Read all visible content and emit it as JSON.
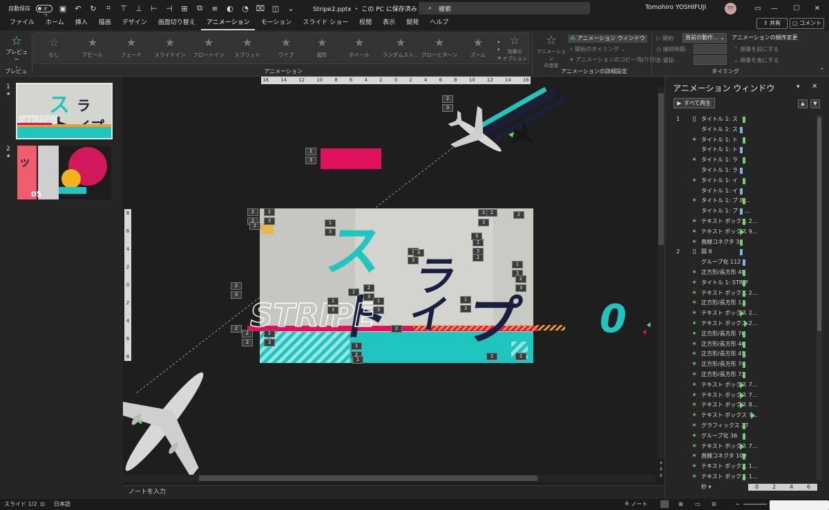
{
  "titlebar": {
    "autosave_label": "自動保存",
    "autosave_state": "オフ",
    "doc_title": "Stripe2.pptx ・ この PC に保存済み ⌄",
    "search_placeholder": "検索",
    "user_name": "Tomohiro YOSHIFUJI",
    "user_initials": "TY"
  },
  "tabs": [
    "ファイル",
    "ホーム",
    "挿入",
    "描画",
    "デザイン",
    "画面切り替え",
    "アニメーション",
    "モーション",
    "スライド ショー",
    "校閲",
    "表示",
    "開発",
    "ヘルプ"
  ],
  "active_tab": "アニメーション",
  "share_label": "共有",
  "comment_label": "コメント",
  "ribbon": {
    "preview_label": "プレビュー",
    "preview_group": "プレビュー",
    "animation_group": "アニメーション",
    "gallery": [
      "なし",
      "アピール",
      "フェード",
      "スライドイン",
      "フロートイン",
      "スプリット",
      "ワイプ",
      "図形",
      "ホイール",
      "ランダムスト…",
      "グローとターン",
      "ズーム"
    ],
    "effect_options": "効果の\nオプション",
    "add_animation": "アニメーション\nの追加",
    "anim_pane_btn": "アニメーション ウィンドウ",
    "start_timing": "開始のタイミング",
    "anim_copy": "アニメーションのコピー/貼り付け",
    "detail_group": "アニメーションの詳細設定",
    "start_label": "開始:",
    "start_value": "直前の動作…",
    "duration_label": "継続時間:",
    "delay_label": "遅延:",
    "reorder_label": "アニメーションの順序変更",
    "move_earlier": "順番を前にする",
    "move_later": "順番を後にする",
    "timing_group": "タイミング"
  },
  "slides": [
    {
      "num": "1",
      "star": "★"
    },
    {
      "num": "2",
      "star": "★"
    }
  ],
  "ruler_h": [
    "16",
    "14",
    "12",
    "10",
    "8",
    "6",
    "4",
    "2",
    "0",
    "2",
    "4",
    "6",
    "8",
    "10",
    "12",
    "14",
    "16"
  ],
  "ruler_v": [
    "8",
    "6",
    "4",
    "2",
    "0",
    "2",
    "4",
    "6",
    "8"
  ],
  "canvas": {
    "kana1": "ス",
    "kana2": "ト",
    "kana3": "ラ",
    "kana4": "イ",
    "kana5": "プ",
    "strip": "STRIPE",
    "zero": "0"
  },
  "notes_placeholder": "ノートを入力",
  "status": {
    "slide": "スライド 1/2",
    "lang": "日本語",
    "notes": "ノート"
  },
  "anim_pane": {
    "title": "アニメーション ウィンドウ",
    "play_all": "すべて再生",
    "items": [
      {
        "num": "1",
        "ic": "mouse",
        "label": "タイトル 1: ス",
        "color": "#6fd36f",
        "bar": 100,
        "kind": "bar"
      },
      {
        "num": "",
        "ic": "dot",
        "label": "タイトル 1: ス",
        "color": "#7fb4e6",
        "bar": 96,
        "kind": "bar"
      },
      {
        "num": "",
        "ic": "star",
        "label": "タイトル 1: ト",
        "color": "#6fd36f",
        "bar": 100,
        "kind": "bar"
      },
      {
        "num": "",
        "ic": "dot",
        "label": "タイトル 1: ト",
        "color": "#7fb4e6",
        "bar": 96,
        "kind": "bar"
      },
      {
        "num": "",
        "ic": "star",
        "label": "タイトル 1: ラ",
        "color": "#6fd36f",
        "bar": 100,
        "kind": "bar"
      },
      {
        "num": "",
        "ic": "dot",
        "label": "タイトル 1: ラ",
        "color": "#7fb4e6",
        "bar": 96,
        "kind": "bar"
      },
      {
        "num": "",
        "ic": "star",
        "label": "タイトル 1: イ",
        "color": "#6fd36f",
        "bar": 100,
        "kind": "bar"
      },
      {
        "num": "",
        "ic": "dot",
        "label": "タイトル 1: イ",
        "color": "#7fb4e6",
        "bar": 96,
        "kind": "bar"
      },
      {
        "num": "",
        "ic": "star",
        "label": "タイトル 1: プ 0 …",
        "color": "#6fd36f",
        "bar": 100,
        "kind": "bar"
      },
      {
        "num": "",
        "ic": "dot",
        "label": "タイトル 1: プ 0 …",
        "color": "#7fb4e6",
        "bar": 96,
        "kind": "bar"
      },
      {
        "num": "",
        "ic": "star",
        "label": "テキスト ボックス 2…",
        "color": "#6fd36f",
        "bar": 100,
        "kind": "bar"
      },
      {
        "num": "",
        "ic": "star",
        "label": "テキスト ボックス 9…",
        "color": "#6fd36f",
        "bar": 96,
        "kind": "tri"
      },
      {
        "num": "",
        "ic": "star",
        "label": "直線コネクタ 31",
        "color": "#6fd36f",
        "bar": 96,
        "kind": "bar"
      },
      {
        "num": "2",
        "ic": "mouse",
        "label": "図 8",
        "color": "#7fb4e6",
        "bar": 96,
        "kind": "bar"
      },
      {
        "num": "",
        "ic": "dot",
        "label": "グループ化 112",
        "color": "#7fb4e6",
        "bar": 100,
        "kind": "bar"
      },
      {
        "num": "",
        "ic": "path",
        "label": "正方形/長方形 48",
        "color": "#6fd36f",
        "bar": 100,
        "kind": "bar"
      },
      {
        "num": "",
        "ic": "path",
        "label": "タイトル 1: STRIP",
        "color": "#6fd36f",
        "bar": 100,
        "kind": "bar"
      },
      {
        "num": "",
        "ic": "path",
        "label": "テキスト ボックス 2…",
        "color": "#6fd36f",
        "bar": 100,
        "kind": "bar"
      },
      {
        "num": "",
        "ic": "path",
        "label": "正方形/長方形 1…",
        "color": "#6fd36f",
        "bar": 100,
        "kind": "bar"
      },
      {
        "num": "",
        "ic": "path",
        "label": "テキスト ボックス 2…",
        "color": "#6fd36f",
        "bar": 96,
        "kind": "tri"
      },
      {
        "num": "",
        "ic": "path",
        "label": "テキスト ボックス 2…",
        "color": "#6fd36f",
        "bar": 102,
        "kind": "tri"
      },
      {
        "num": "",
        "ic": "path",
        "label": "正方形/長方形 76",
        "color": "#6fd36f",
        "bar": 100,
        "kind": "bar"
      },
      {
        "num": "",
        "ic": "path",
        "label": "正方形/長方形 46",
        "color": "#6fd36f",
        "bar": 100,
        "kind": "bar"
      },
      {
        "num": "",
        "ic": "path",
        "label": "正方形/長方形 45",
        "color": "#6fd36f",
        "bar": 100,
        "kind": "bar"
      },
      {
        "num": "",
        "ic": "path",
        "label": "正方形/長方形 74",
        "color": "#6fd36f",
        "bar": 100,
        "kind": "bar"
      },
      {
        "num": "",
        "ic": "path",
        "label": "正方形/長方形 73",
        "color": "#6fd36f",
        "bar": 100,
        "kind": "bar"
      },
      {
        "num": "",
        "ic": "path",
        "label": "テキスト ボックス 7…",
        "color": "#6fd36f",
        "bar": 96,
        "kind": "tri"
      },
      {
        "num": "",
        "ic": "path",
        "label": "テキスト ボックス 7…",
        "color": "#6fd36f",
        "bar": 96,
        "kind": "tri"
      },
      {
        "num": "",
        "ic": "path",
        "label": "テキスト ボックス 8…",
        "color": "#6fd36f",
        "bar": 96,
        "kind": "tri"
      },
      {
        "num": "",
        "ic": "path",
        "label": "テキスト ボックス 7…",
        "color": "#6fd36f",
        "bar": 112,
        "kind": "tri"
      },
      {
        "num": "",
        "ic": "path",
        "label": "グラフィックス 27",
        "color": "#6fd36f",
        "bar": 100,
        "kind": "bar"
      },
      {
        "num": "",
        "ic": "path",
        "label": "グループ化 36",
        "color": "#6fd36f",
        "bar": 100,
        "kind": "bar"
      },
      {
        "num": "",
        "ic": "path",
        "label": "テキスト ボックス 7…",
        "color": "#6fd36f",
        "bar": 96,
        "kind": "tri"
      },
      {
        "num": "",
        "ic": "path",
        "label": "直線コネクタ 109",
        "color": "#6fd36f",
        "bar": 100,
        "kind": "bar"
      },
      {
        "num": "",
        "ic": "path",
        "label": "テキスト ボックス 1…",
        "color": "#6fd36f",
        "bar": 100,
        "kind": "bar"
      },
      {
        "num": "",
        "ic": "path",
        "label": "テキスト ボックス 1…",
        "color": "#6fd36f",
        "bar": 100,
        "kind": "bar"
      }
    ],
    "seconds_label": "秒 ▾",
    "timeline": [
      "0",
      "2",
      "4",
      "6"
    ]
  },
  "colors": {
    "accent": "#1fc6c0",
    "pink": "#e0105a",
    "navy": "#1b1f3f",
    "orange": "#f39a28"
  }
}
